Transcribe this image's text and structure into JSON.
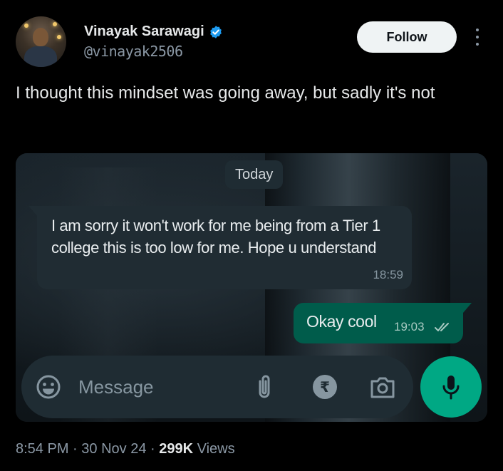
{
  "author": {
    "name": "Vinayak Sarawagi",
    "handle": "@vinayak2506",
    "avatar_icon": "avatar-photo",
    "verified_icon": "verified-badge-icon"
  },
  "actions": {
    "follow_label": "Follow",
    "more_icon": "more-dots-icon"
  },
  "tweet": {
    "text": "I thought this mindset was going away, but sadly it's not"
  },
  "chat": {
    "date_chip": "Today",
    "messages": [
      {
        "direction": "incoming",
        "text": "I am sorry it won't work for me being from a Tier 1 college this is too low for me. Hope u understand",
        "time": "18:59"
      },
      {
        "direction": "outgoing",
        "text": "Okay cool",
        "time": "19:03",
        "status_icon": "double-check-icon"
      }
    ],
    "input": {
      "placeholder": "Message",
      "icons": [
        "emoji-icon",
        "attach-clip-icon",
        "rupee-payment-icon",
        "camera-icon"
      ],
      "send_icon": "mic-icon"
    },
    "colors": {
      "incoming_bubble": "#202c33",
      "outgoing_bubble": "#005c4b",
      "mic_button": "#00a884"
    }
  },
  "meta": {
    "time": "8:54 PM",
    "separator": " · ",
    "date": "30 Nov 24",
    "views_count": "299K",
    "views_label": " Views"
  }
}
